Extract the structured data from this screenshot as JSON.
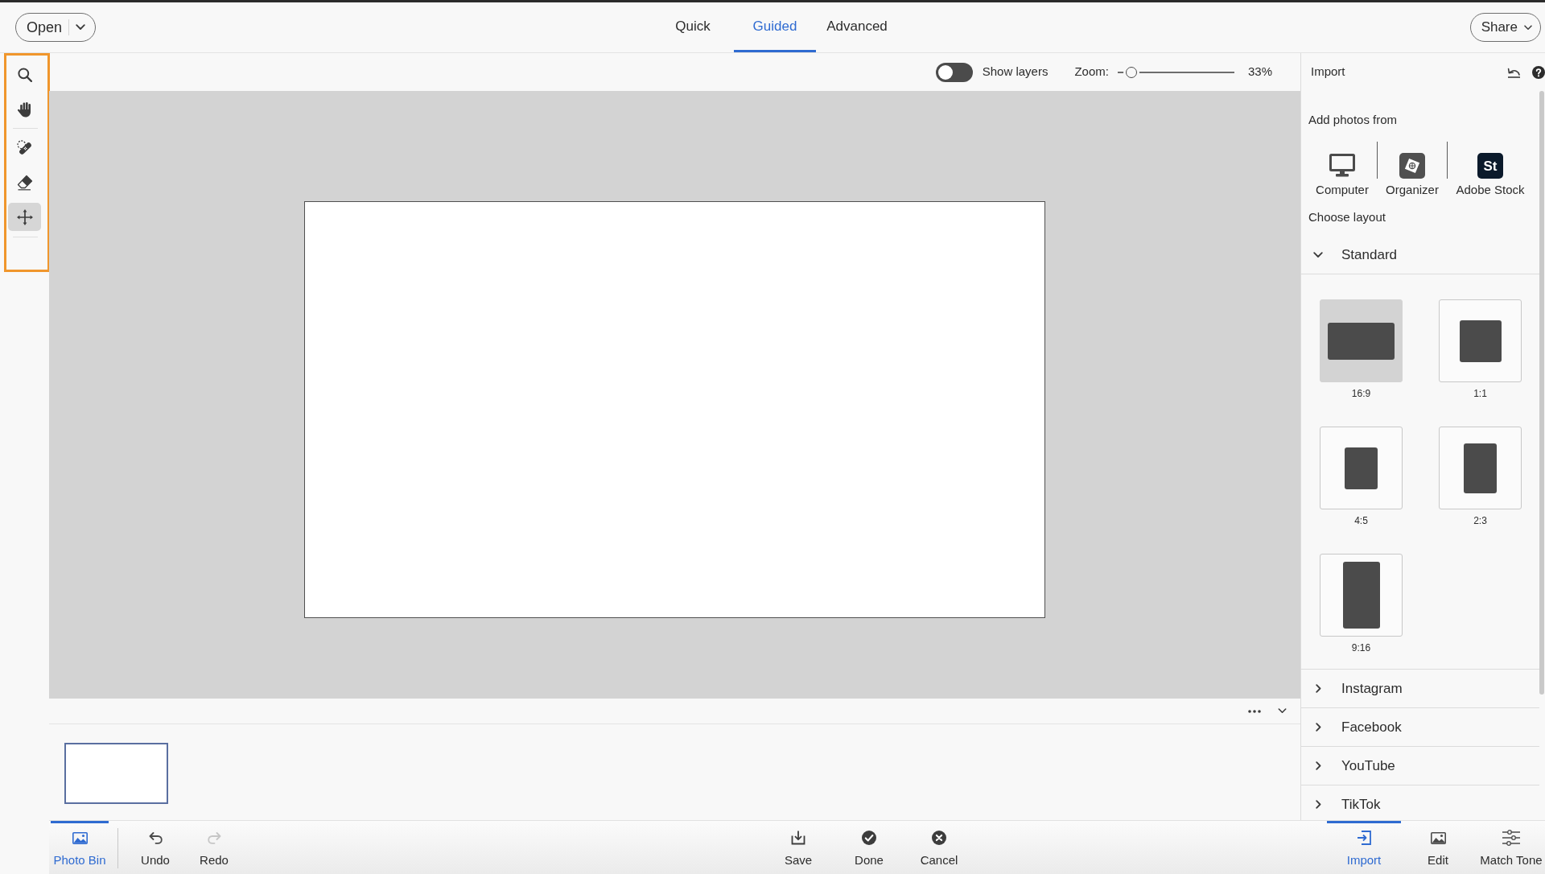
{
  "top_bar": {
    "open_button": {
      "label": "Open"
    },
    "mode_tabs": [
      {
        "label": "Quick",
        "selected": false
      },
      {
        "label": "Guided",
        "selected": true
      },
      {
        "label": "Advanced",
        "selected": false
      }
    ],
    "share_button": {
      "label": "Share"
    }
  },
  "tools": [
    {
      "selected": false
    },
    {
      "selected": false
    },
    {
      "selected": false
    },
    {
      "selected": false
    },
    {
      "selected": true
    }
  ],
  "options_bar": {
    "show_layers": {
      "label": "Show layers",
      "on": false
    },
    "zoom": {
      "label": "Zoom:",
      "level": 0.12,
      "reading": "33%"
    }
  },
  "photo_bin": {
    "thumbnails": [
      {
        "selected": true
      }
    ]
  },
  "right_panel": {
    "title": "Import",
    "add_photos_label": "Add photos from",
    "sources": [
      {
        "label": "Computer"
      },
      {
        "label": "Organizer"
      },
      {
        "label": "Adobe Stock",
        "logo_text": "St"
      }
    ],
    "choose_layout_label": "Choose layout",
    "sections": [
      {
        "title": "Standard",
        "expanded": true,
        "layouts": [
          {
            "label": "16:9",
            "selected": true
          },
          {
            "label": "1:1",
            "selected": false
          },
          {
            "label": "4:5",
            "selected": false
          },
          {
            "label": "2:3",
            "selected": false
          },
          {
            "label": "9:16",
            "selected": false
          }
        ]
      },
      {
        "title": "Instagram",
        "expanded": false
      },
      {
        "title": "Facebook",
        "expanded": false
      },
      {
        "title": "YouTube",
        "expanded": false
      },
      {
        "title": "TikTok",
        "expanded": false
      }
    ]
  },
  "bottom_bar": {
    "photo_bin_tab": {
      "label": "Photo Bin",
      "selected": true
    },
    "history_buttons": [
      {
        "label": "Undo",
        "disabled": false
      },
      {
        "label": "Redo",
        "disabled": true
      }
    ],
    "actions": [
      {
        "label": "Save"
      },
      {
        "label": "Done"
      },
      {
        "label": "Cancel"
      }
    ],
    "panel_tabs": [
      {
        "label": "Import",
        "selected": true
      },
      {
        "label": "Edit",
        "selected": false
      },
      {
        "label": "Match Tone",
        "selected": false
      }
    ]
  }
}
